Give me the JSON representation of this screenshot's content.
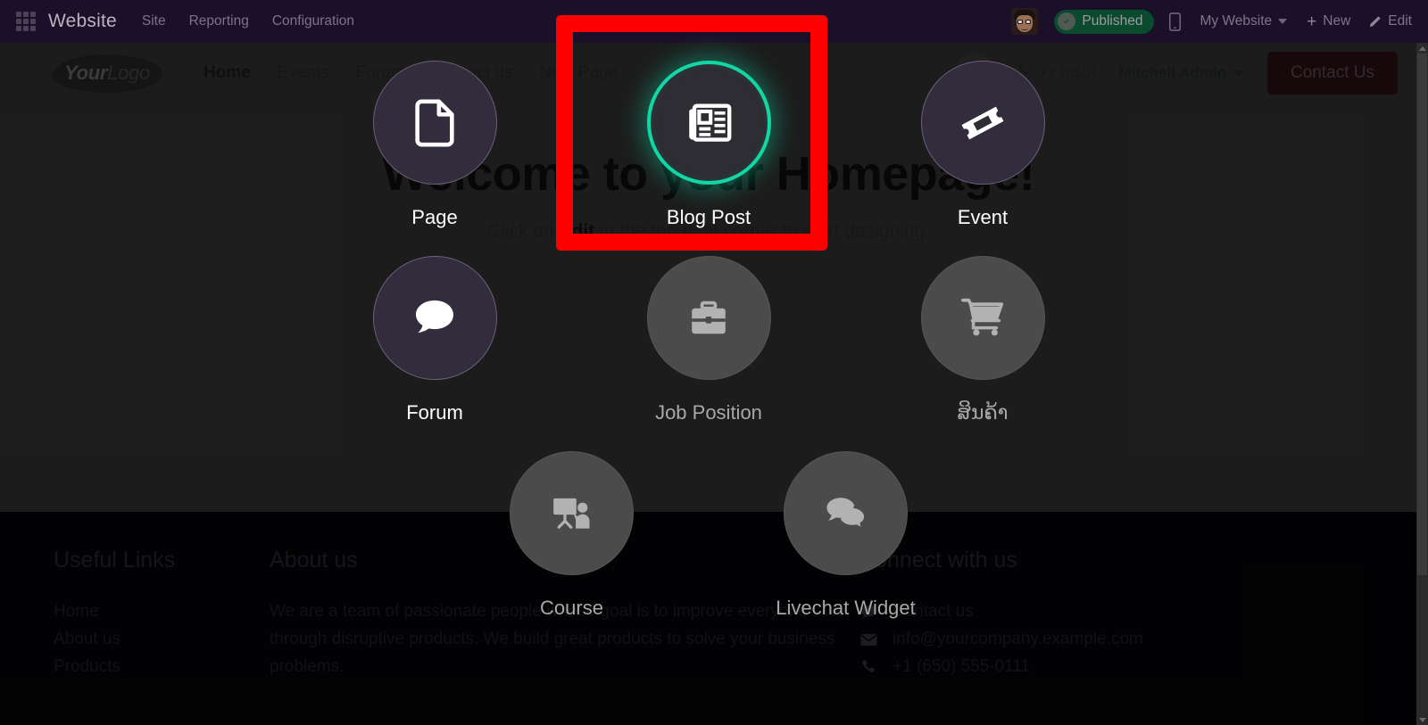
{
  "backend_bar": {
    "apps_icon": "apps-grid-icon",
    "app_name": "Website",
    "menus": [
      "Site",
      "Reporting",
      "Configuration"
    ],
    "avatar": "user-avatar",
    "publish_status": "Published",
    "mobile_preview_icon": "mobile-icon",
    "site_selector": "My Website",
    "new_button": "New",
    "edit_button": "Edit",
    "plus_glyph": "+",
    "pencil_icon": "pencil-icon"
  },
  "website_nav": {
    "logo_primary": "Your",
    "logo_secondary": "Logo",
    "links": [
      {
        "label": "Home",
        "active": true
      },
      {
        "label": "Events",
        "active": false
      },
      {
        "label": "Forum",
        "active": false
      },
      {
        "label": "Contact us",
        "active": false
      },
      {
        "label": "New Page",
        "active": false
      }
    ],
    "search_icon": "search-icon",
    "phone_icon": "phone-icon",
    "phone": "+1 (650)",
    "user": "Mitchell Admin",
    "cta": "Contact Us"
  },
  "hero": {
    "title": "Welcome to your Homepage!",
    "subtitle_before": "Click on ",
    "subtitle_bold": "Edit",
    "subtitle_after": " in the top right corner to start designing."
  },
  "new_content_picker": {
    "rows": [
      [
        {
          "label": "Page",
          "icon": "document-icon",
          "state": "enabled"
        },
        {
          "label": "Blog Post",
          "icon": "newspaper-icon",
          "state": "selected"
        },
        {
          "label": "Event",
          "icon": "ticket-icon",
          "state": "enabled"
        }
      ],
      [
        {
          "label": "Forum",
          "icon": "comment-icon",
          "state": "enabled"
        },
        {
          "label": "Job Position",
          "icon": "briefcase-icon",
          "state": "disabled"
        },
        {
          "label": "ສິນຄ້າ",
          "icon": "shopping-cart-icon",
          "state": "disabled"
        }
      ],
      [
        {
          "label": "Course",
          "icon": "chalkboard-teacher-icon",
          "state": "disabled"
        },
        {
          "label": "Livechat Widget",
          "icon": "comments-icon",
          "state": "disabled"
        }
      ]
    ]
  },
  "annotation": {
    "target": "Blog Post",
    "highlight_color": "#ff0000",
    "selection_ring_color": "#12d6a4"
  },
  "footer": {
    "useful_links": {
      "heading": "Useful Links",
      "items": [
        "Home",
        "About us",
        "Products"
      ]
    },
    "about": {
      "heading": "About us",
      "text": "We are a team of passionate people whose goal is to improve everyone's life through disruptive products. We build great products to solve your business problems."
    },
    "connect": {
      "heading": "Connect with us",
      "rows": [
        {
          "icon": "comment-icon",
          "text": "Contact us"
        },
        {
          "icon": "envelope-icon",
          "text": "info@yourcompany.example.com"
        },
        {
          "icon": "phone-icon",
          "text": "+1 (650) 555-0111"
        }
      ]
    }
  }
}
